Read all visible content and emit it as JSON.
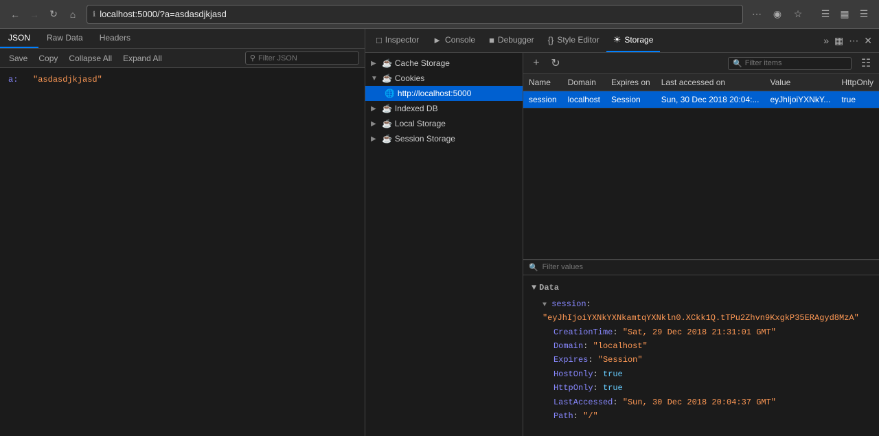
{
  "browser": {
    "url": "localhost:5000/?a=asdasdjkjasd",
    "back_disabled": false,
    "forward_disabled": true
  },
  "json_panel": {
    "tabs": [
      {
        "id": "json",
        "label": "JSON",
        "active": true
      },
      {
        "id": "raw",
        "label": "Raw Data",
        "active": false
      },
      {
        "id": "headers",
        "label": "Headers",
        "active": false
      }
    ],
    "toolbar": {
      "save": "Save",
      "copy": "Copy",
      "collapse": "Collapse All",
      "expand": "Expand All",
      "filter_placeholder": "Filter JSON"
    },
    "content": {
      "key": "a:",
      "value": "\"asdasdjkjasd\""
    }
  },
  "devtools": {
    "tabs": [
      {
        "id": "inspector",
        "label": "Inspector",
        "icon": "⬜",
        "active": false
      },
      {
        "id": "console",
        "label": "Console",
        "icon": "▷",
        "active": false
      },
      {
        "id": "debugger",
        "label": "Debugger",
        "icon": "⬛",
        "active": false
      },
      {
        "id": "style-editor",
        "label": "Style Editor",
        "icon": "{}",
        "active": false
      },
      {
        "id": "storage",
        "label": "Storage",
        "icon": "☁",
        "active": true
      }
    ]
  },
  "storage_tree": {
    "items": [
      {
        "id": "cache-storage",
        "label": "Cache Storage",
        "expanded": false,
        "indent": false
      },
      {
        "id": "cookies",
        "label": "Cookies",
        "expanded": true,
        "indent": false
      },
      {
        "id": "cookies-localhost",
        "label": "http://localhost:5000",
        "expanded": false,
        "indent": true,
        "active": true
      },
      {
        "id": "indexed-db",
        "label": "Indexed DB",
        "expanded": false,
        "indent": false
      },
      {
        "id": "local-storage",
        "label": "Local Storage",
        "expanded": false,
        "indent": false
      },
      {
        "id": "session-storage",
        "label": "Session Storage",
        "expanded": false,
        "indent": false
      }
    ]
  },
  "storage_toolbar": {
    "add_label": "+",
    "refresh_label": "↻",
    "filter_placeholder": "Filter items"
  },
  "cookies_table": {
    "columns": [
      "Name",
      "Domain",
      "Expires on",
      "Last accessed on",
      "Value",
      "HttpOnly"
    ],
    "rows": [
      {
        "name": "session",
        "domain": "localhost",
        "expires": "Session",
        "last_accessed": "Sun, 30 Dec 2018 20:04:...",
        "value": "eyJhIjoiYXNkY...",
        "http_only": "true",
        "selected": true
      }
    ]
  },
  "filter_values": {
    "placeholder": "Filter values"
  },
  "cookie_detail": {
    "section_label": "Data",
    "session_key": "session",
    "session_value": "\"eyJhIjoiYXNkYXNkamtqYXNkln0.XCkk1Q.tTPu2Zhvn9KxgkP35ERAgyd8MzA\"",
    "fields": [
      {
        "key": "CreationTime",
        "value": "\"Sat, 29 Dec 2018 21:31:01 GMT\"",
        "type": "string"
      },
      {
        "key": "Domain",
        "value": "\"localhost\"",
        "type": "string"
      },
      {
        "key": "Expires",
        "value": "\"Session\"",
        "type": "string"
      },
      {
        "key": "HostOnly",
        "value": "true",
        "type": "bool"
      },
      {
        "key": "HttpOnly",
        "value": "true",
        "type": "bool"
      },
      {
        "key": "LastAccessed",
        "value": "\"Sun, 30 Dec 2018 20:04:37 GMT\"",
        "type": "string"
      },
      {
        "key": "Path",
        "value": "\"/\"",
        "type": "string"
      }
    ]
  }
}
